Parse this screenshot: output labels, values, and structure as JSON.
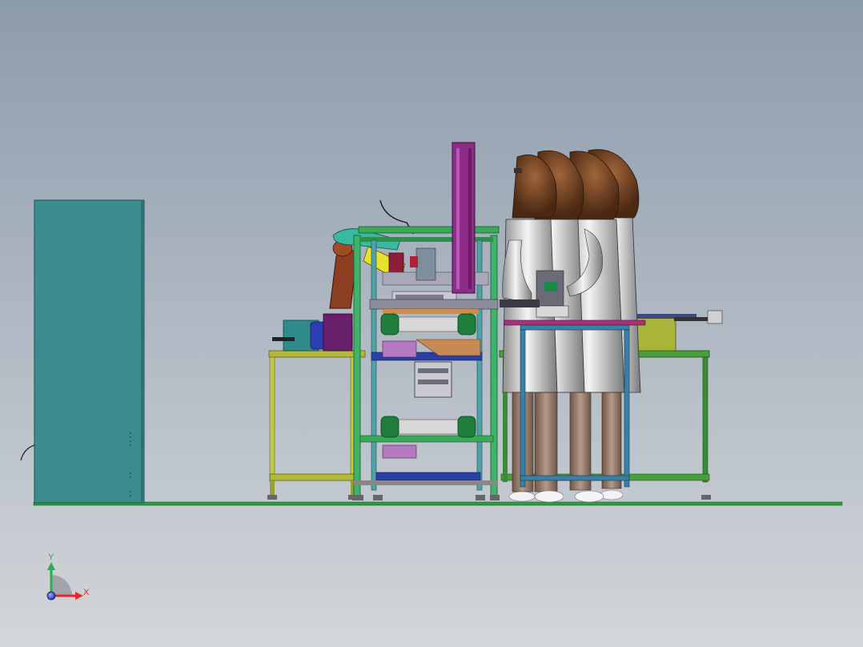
{
  "viewport": {
    "background_top": "#8C9BAC",
    "background_bottom": "#D3D6DA"
  },
  "triad": {
    "x_label": "X",
    "y_label": "Y",
    "x_color": "#E8262B",
    "y_color": "#22B14C",
    "z_color": "#2F4BD6"
  },
  "model": {
    "cabinet_color": "#3B8C8E",
    "floor_color": "#2E9E3A",
    "robot_color": "#8B3E22",
    "column_color": "#8E2C8A",
    "hair_color": "#6A3A1E",
    "coat_color": "#C9C9C9"
  }
}
